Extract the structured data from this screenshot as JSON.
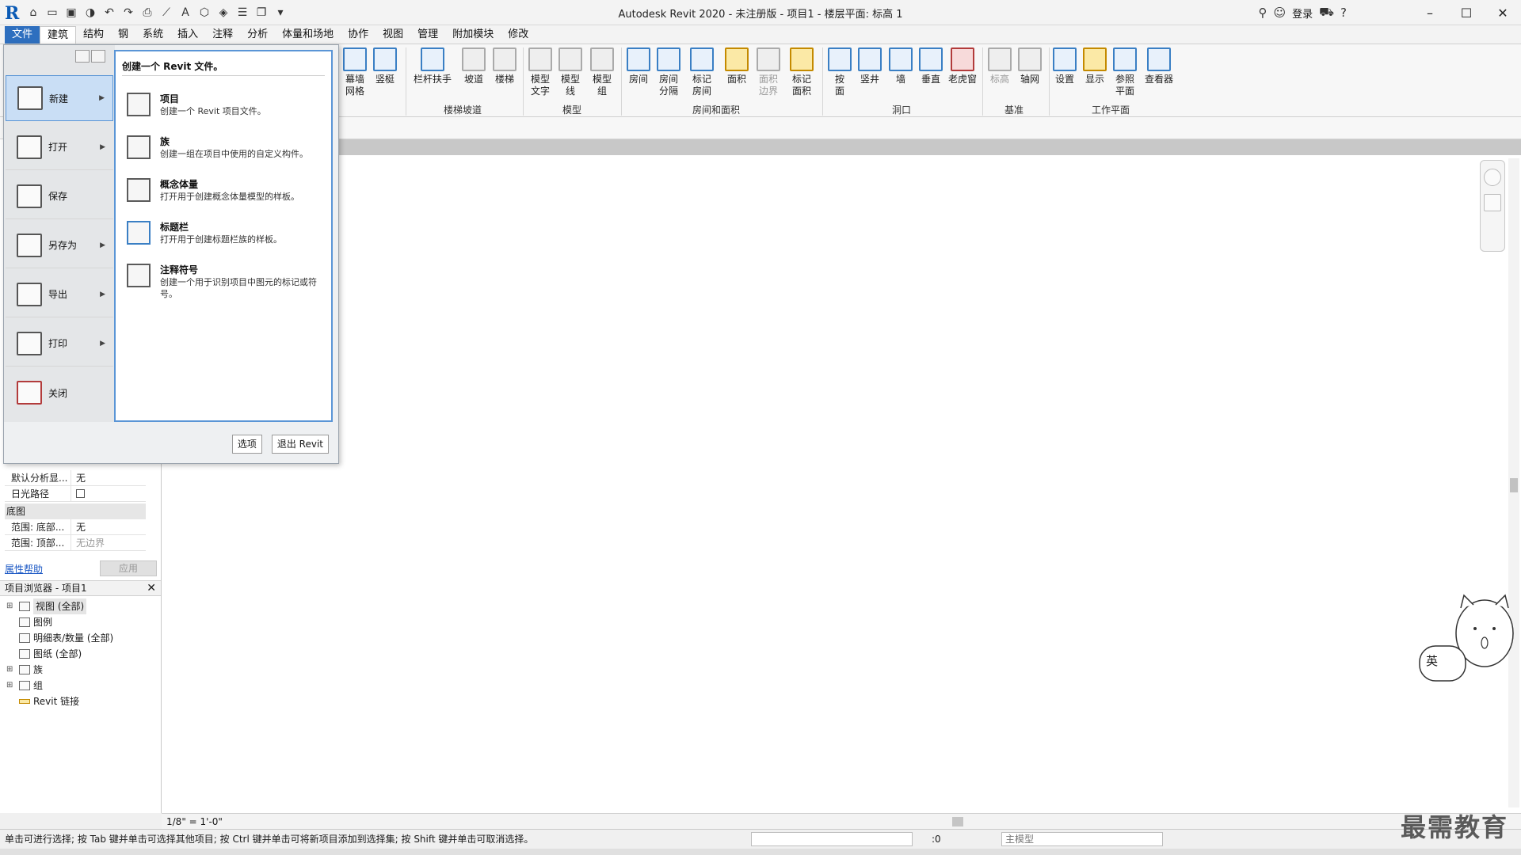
{
  "window": {
    "title": "Autodesk Revit 2020 - 未注册版 - 项目1 - 楼层平面: 标高 1",
    "login_label": "登录"
  },
  "menu_tabs": [
    "文件",
    "建筑",
    "结构",
    "钢",
    "系统",
    "插入",
    "注释",
    "分析",
    "体量和场地",
    "协作",
    "视图",
    "管理",
    "附加模块",
    "修改"
  ],
  "ribbon": {
    "buttons": [
      {
        "label": "幕墙\n网格"
      },
      {
        "label": "竖梃"
      },
      {
        "label": "栏杆扶手"
      },
      {
        "label": "坡道"
      },
      {
        "label": "楼梯"
      },
      {
        "label": "模型\n文字"
      },
      {
        "label": "模型\n线"
      },
      {
        "label": "模型\n组"
      },
      {
        "label": "房间"
      },
      {
        "label": "房间\n分隔"
      },
      {
        "label": "标记\n房间"
      },
      {
        "label": "面积"
      },
      {
        "label": "面积\n边界"
      },
      {
        "label": "标记\n面积"
      },
      {
        "label": "按\n面"
      },
      {
        "label": "竖井"
      },
      {
        "label": "墙"
      },
      {
        "label": "垂直"
      },
      {
        "label": "老虎窗"
      },
      {
        "label": "标高"
      },
      {
        "label": "轴网"
      },
      {
        "label": "设置"
      },
      {
        "label": "显示"
      },
      {
        "label": "参照\n平面"
      },
      {
        "label": "查看器"
      }
    ],
    "groups": [
      "楼梯坡道",
      "模型",
      "房间和面积",
      "洞口",
      "基准",
      "工作平面"
    ]
  },
  "app_menu": {
    "items": [
      {
        "label": "新建",
        "has_arrow": true
      },
      {
        "label": "打开",
        "has_arrow": true
      },
      {
        "label": "保存",
        "has_arrow": false
      },
      {
        "label": "另存为",
        "has_arrow": true
      },
      {
        "label": "导出",
        "has_arrow": true
      },
      {
        "label": "打印",
        "has_arrow": true
      },
      {
        "label": "关闭",
        "has_arrow": false
      }
    ],
    "submenu_header": "创建一个 Revit 文件。",
    "submenu_items": [
      {
        "title": "项目",
        "desc": "创建一个 Revit 项目文件。"
      },
      {
        "title": "族",
        "desc": "创建一组在项目中使用的自定义构件。"
      },
      {
        "title": "概念体量",
        "desc": "打开用于创建概念体量模型的样板。"
      },
      {
        "title": "标题栏",
        "desc": "打开用于创建标题栏族的样板。"
      },
      {
        "title": "注释符号",
        "desc": "创建一个用于识别项目中图元的标记或符号。"
      }
    ],
    "options_label": "选项",
    "exit_label": "退出 Revit"
  },
  "properties": {
    "rows": [
      {
        "key": "默认分析显...",
        "value": "无"
      },
      {
        "key": "日光路径",
        "value": ""
      }
    ],
    "section": "底图",
    "rows2": [
      {
        "key": "范围: 底部...",
        "value": "无"
      },
      {
        "key": "范围: 顶部...",
        "value": "无边界"
      }
    ],
    "help_link": "属性帮助",
    "apply_label": "应用"
  },
  "project_browser": {
    "title": "项目浏览器 - 项目1",
    "nodes": [
      {
        "label": "视图 (全部)",
        "expandable": true
      },
      {
        "label": "图例",
        "expandable": false
      },
      {
        "label": "明细表/数量 (全部)",
        "expandable": false
      },
      {
        "label": "图纸 (全部)",
        "expandable": false
      },
      {
        "label": "族",
        "expandable": true
      },
      {
        "label": "组",
        "expandable": true
      },
      {
        "label": "Revit 链接",
        "expandable": false
      }
    ]
  },
  "view_control": {
    "scale": "1/8\" = 1'-0\""
  },
  "status": {
    "message": "单击可进行选择; 按 Tab 键并单击可选择其他项目; 按 Ctrl 键并单击可将新项目添加到选择集; 按 Shift 键并单击可取消选择。",
    "count": ":0",
    "model_combo": "主模型"
  },
  "watermark": "最需教育",
  "mascot_text": "英"
}
